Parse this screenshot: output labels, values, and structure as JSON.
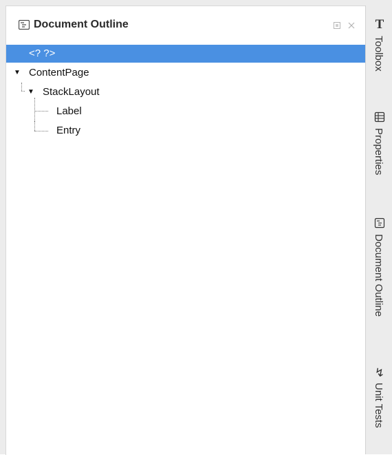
{
  "panel": {
    "title": "Document Outline",
    "icon": "document-outline-icon",
    "controls": [
      "dock-icon",
      "close-icon"
    ]
  },
  "tree": {
    "items": [
      {
        "label": "<? ?>",
        "selected": true
      },
      {
        "label": "ContentPage",
        "expanded": true
      },
      {
        "label": "StackLayout",
        "expanded": true
      },
      {
        "label": "Label"
      },
      {
        "label": "Entry"
      }
    ]
  },
  "sidebar": {
    "tabs": [
      {
        "label": "Toolbox",
        "icon": "toolbox-icon"
      },
      {
        "label": "Properties",
        "icon": "properties-icon"
      },
      {
        "label": "Document Outline",
        "icon": "document-outline-icon"
      },
      {
        "label": "Unit Tests",
        "icon": "unit-tests-icon"
      }
    ]
  },
  "colors": {
    "selection": "#4a90e2",
    "sidebar_bg": "#ececec",
    "panel_bg": "#ffffff"
  }
}
